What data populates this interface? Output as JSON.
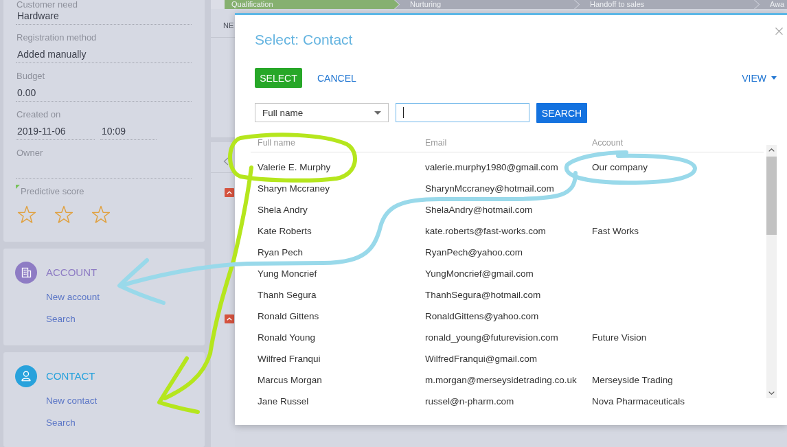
{
  "sidebar": {
    "fields": [
      {
        "label": "Customer need",
        "value": "Hardware"
      },
      {
        "label": "Registration method",
        "value": "Added manually"
      },
      {
        "label": "Budget",
        "value": "0.00"
      },
      {
        "label": "Created on",
        "value": "2019-11-06",
        "time": "10:09"
      },
      {
        "label": "Owner"
      }
    ],
    "predictive_score": {
      "label": "Predictive score",
      "stars": 0
    },
    "sections": [
      {
        "title": "ACCOUNT",
        "color": "#8e7cc4",
        "links": [
          "New account",
          "Search"
        ]
      },
      {
        "title": "CONTACT",
        "color": "#28a2dc",
        "links": [
          "New contact",
          "Search"
        ]
      }
    ]
  },
  "page": {
    "stages": [
      {
        "label": "Qualification",
        "selected": true
      },
      {
        "label": "Nurturing",
        "selected": false
      },
      {
        "label": "Handoff to sales",
        "selected": false
      },
      {
        "label": "Awa",
        "selected": false
      }
    ],
    "tab": "NE"
  },
  "dialog": {
    "title": "Select: Contact",
    "actions": [
      {
        "label": "SELECT",
        "kind": "primary"
      },
      {
        "label": "CANCEL",
        "kind": "link"
      }
    ],
    "view_menu": "VIEW",
    "filter": {
      "column": "Full name",
      "search_input": {
        "focused": true
      },
      "search_button": "SEARCH"
    },
    "table": {
      "columns": [
        "Full name",
        "Email",
        "Account"
      ],
      "rows": [
        {
          "full_name": "Valerie E. Murphy",
          "email": "valerie.murphy1980@gmail.com",
          "account": "Our company"
        },
        {
          "full_name": "Sharyn Mccraney",
          "email": "SharynMccraney@hotmail.com"
        },
        {
          "full_name": "Shela Andry",
          "email": "ShelaAndry@hotmail.com"
        },
        {
          "full_name": "Kate Roberts",
          "email": "kate.roberts@fast-works.com",
          "account": "Fast Works"
        },
        {
          "full_name": "Ryan Pech",
          "email": "RyanPech@yahoo.com"
        },
        {
          "full_name": "Yung Moncrief",
          "email": "YungMoncrief@gmail.com"
        },
        {
          "full_name": "Thanh Segura",
          "email": "ThanhSegura@hotmail.com"
        },
        {
          "full_name": "Ronald Gittens",
          "email": "RonaldGittens@yahoo.com"
        },
        {
          "full_name": "Ronald Young",
          "email": "ronald_young@futurevision.com",
          "account": "Future Vision"
        },
        {
          "full_name": "Wilfred Franqui",
          "email": "WilfredFranqui@gmail.com"
        },
        {
          "full_name": "Marcus Morgan",
          "email": "m.morgan@merseysidetrading.co.uk",
          "account": "Merseyside Trading"
        },
        {
          "full_name": "Jane Russel",
          "email": "russel@n-pharm.com",
          "account": "Nova Pharmaceuticals"
        }
      ]
    }
  }
}
